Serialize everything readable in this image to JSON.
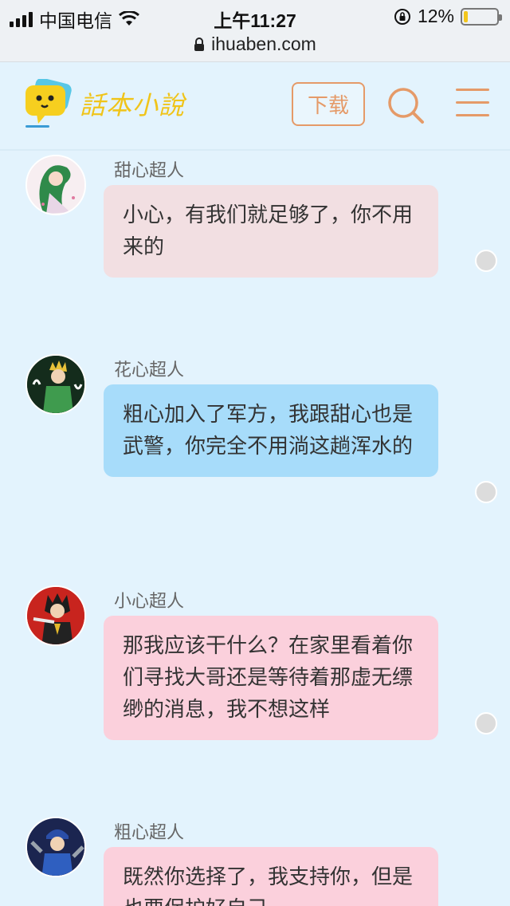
{
  "status_bar": {
    "carrier": "中国电信",
    "time": "上午11:27",
    "battery_percent": "12%",
    "battery_level": 0.12
  },
  "browser": {
    "url": "ihuaben.com"
  },
  "header": {
    "logo_text": "話本小說",
    "download_label": "下载"
  },
  "colors": {
    "accent": "#e59a68",
    "page_bg": "#e3f3fd",
    "bubble_pink_pale": "#f2dfe2",
    "bubble_blue": "#a7dcfa",
    "bubble_pink": "#fbd0dc"
  },
  "messages": [
    {
      "name": "甜心超人",
      "text": "小心，有我们就足够了，你不用来的",
      "style": "pink_pale"
    },
    {
      "name": "花心超人",
      "text": "粗心加入了军方，我跟甜心也是武警，你完全不用淌这趟浑水的",
      "style": "blue"
    },
    {
      "name": "小心超人",
      "text": "那我应该干什么？在家里看着你们寻找大哥还是等待着那虚无缥缈的消息，我不想这样",
      "style": "pink"
    },
    {
      "name": "粗心超人",
      "text": "既然你选择了，我支持你，但是也要保护好自己",
      "style": "pink"
    }
  ]
}
